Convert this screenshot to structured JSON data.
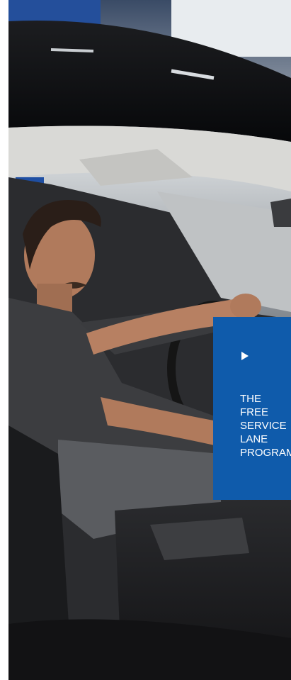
{
  "hero": {
    "image_icon": "photo-mechanic-in-car"
  },
  "promo_card": {
    "play_icon": "play-icon",
    "title_lines": [
      "THE",
      "FREE",
      "SERVICE",
      "LANE",
      "PROGRAM"
    ],
    "background_color": "#0f5bab",
    "text_color": "#ffffff"
  }
}
